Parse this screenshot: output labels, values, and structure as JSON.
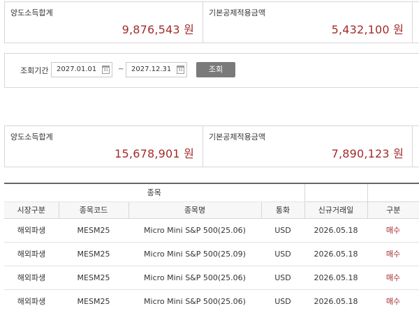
{
  "summary_top": {
    "label1": "양도소득합계",
    "amount1": "9,876,543 원",
    "label2": "기본공제적용금액",
    "amount2": "5,432,100 원"
  },
  "search": {
    "label": "조회기간",
    "date_from": "2027.01.01",
    "date_to": "2027.12.31",
    "separator": "~",
    "calendar_icon_text": "31",
    "button_label": "조회"
  },
  "summary_bottom": {
    "label1": "양도소득합계",
    "amount1": "15,678,901 원",
    "label2": "기본공제적용금액",
    "amount2": "7,890,123 원"
  },
  "table": {
    "group_header": "종목",
    "columns": [
      "시장구분",
      "종목코드",
      "종목명",
      "통화",
      "신규거래일",
      "구분"
    ],
    "rows": [
      [
        "해외파생",
        "MESM25",
        "Micro Mini S&P 500(25.06)",
        "USD",
        "2026.05.18",
        "매수"
      ],
      [
        "해외파생",
        "MESM25",
        "Micro Mini S&P 500(25.09)",
        "USD",
        "2026.05.18",
        "매수"
      ],
      [
        "해외파생",
        "MESM25",
        "Micro Mini S&P 500(25.06)",
        "USD",
        "2026.05.18",
        "매수"
      ],
      [
        "해외파생",
        "MESM25",
        "Micro Mini S&P 500(25.06)",
        "USD",
        "2026.05.18",
        "매수"
      ]
    ]
  },
  "colors": {
    "amount": "#a42b2b",
    "buy": "#a42b2b",
    "button": "#7a7a7a"
  },
  "icons": {
    "date_picker": "calendar-icon"
  }
}
